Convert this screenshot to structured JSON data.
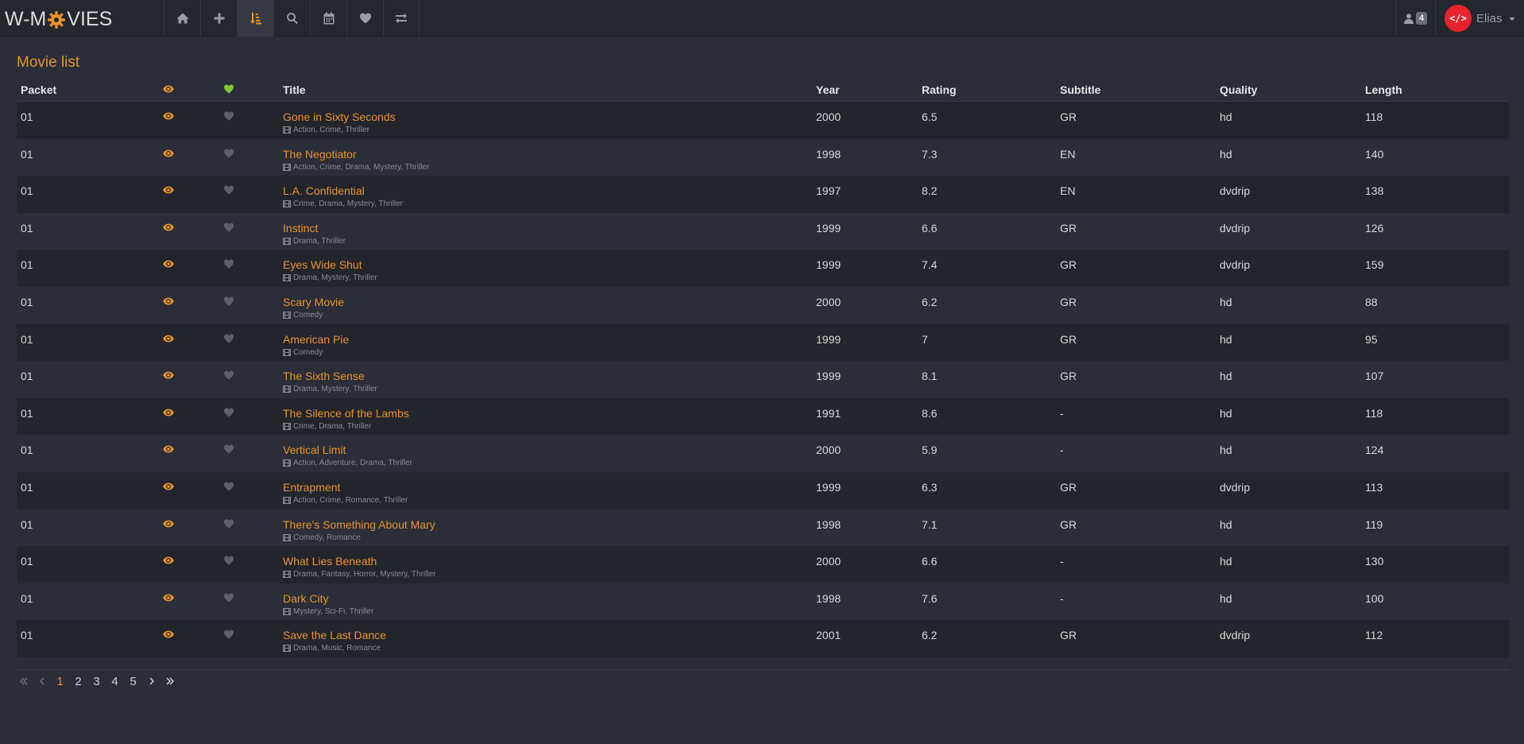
{
  "brand": {
    "pre": "W-M",
    "post": "VIES"
  },
  "nav": [
    {
      "name": "home-icon",
      "active": false
    },
    {
      "name": "plus-icon",
      "active": false
    },
    {
      "name": "sort-amount-icon",
      "active": true
    },
    {
      "name": "search-icon",
      "active": false
    },
    {
      "name": "calendar-icon",
      "active": false
    },
    {
      "name": "heart-icon",
      "active": false
    },
    {
      "name": "exchange-icon",
      "active": false
    }
  ],
  "online_count": "4",
  "user": {
    "avatar_text": "</>",
    "name": "Elias"
  },
  "page_title": "Movie list",
  "columns": {
    "packet": "Packet",
    "title": "Title",
    "year": "Year",
    "rating": "Rating",
    "subtitle": "Subtitle",
    "quality": "Quality",
    "length": "Length"
  },
  "colors": {
    "accent": "#e8922b",
    "liked": "#7ec832",
    "not_liked": "#5d6068",
    "avatar": "#e8232e"
  },
  "movies": [
    {
      "packet": "01",
      "title": "Gone in Sixty Seconds",
      "genres": "Action, Crime, Thriller",
      "year": "2000",
      "rating": "6.5",
      "subtitle": "GR",
      "quality": "hd",
      "length": "118"
    },
    {
      "packet": "01",
      "title": "The Negotiator",
      "genres": "Action, Crime, Drama, Mystery, Thriller",
      "year": "1998",
      "rating": "7.3",
      "subtitle": "EN",
      "quality": "hd",
      "length": "140"
    },
    {
      "packet": "01",
      "title": "L.A. Confidential",
      "genres": "Crime, Drama, Mystery, Thriller",
      "year": "1997",
      "rating": "8.2",
      "subtitle": "EN",
      "quality": "dvdrip",
      "length": "138"
    },
    {
      "packet": "01",
      "title": "Instinct",
      "genres": "Drama, Thriller",
      "year": "1999",
      "rating": "6.6",
      "subtitle": "GR",
      "quality": "dvdrip",
      "length": "126"
    },
    {
      "packet": "01",
      "title": "Eyes Wide Shut",
      "genres": "Drama, Mystery, Thriller",
      "year": "1999",
      "rating": "7.4",
      "subtitle": "GR",
      "quality": "dvdrip",
      "length": "159"
    },
    {
      "packet": "01",
      "title": "Scary Movie",
      "genres": "Comedy",
      "year": "2000",
      "rating": "6.2",
      "subtitle": "GR",
      "quality": "hd",
      "length": "88"
    },
    {
      "packet": "01",
      "title": "American Pie",
      "genres": "Comedy",
      "year": "1999",
      "rating": "7",
      "subtitle": "GR",
      "quality": "hd",
      "length": "95"
    },
    {
      "packet": "01",
      "title": "The Sixth Sense",
      "genres": "Drama, Mystery, Thriller",
      "year": "1999",
      "rating": "8.1",
      "subtitle": "GR",
      "quality": "hd",
      "length": "107"
    },
    {
      "packet": "01",
      "title": "The Silence of the Lambs",
      "genres": "Crime, Drama, Thriller",
      "year": "1991",
      "rating": "8.6",
      "subtitle": "-",
      "quality": "hd",
      "length": "118"
    },
    {
      "packet": "01",
      "title": "Vertical Limit",
      "genres": "Action, Adventure, Drama, Thriller",
      "year": "2000",
      "rating": "5.9",
      "subtitle": "-",
      "quality": "hd",
      "length": "124"
    },
    {
      "packet": "01",
      "title": "Entrapment",
      "genres": "Action, Crime, Romance, Thriller",
      "year": "1999",
      "rating": "6.3",
      "subtitle": "GR",
      "quality": "dvdrip",
      "length": "113"
    },
    {
      "packet": "01",
      "title": "There's Something About Mary",
      "genres": "Comedy, Romance",
      "year": "1998",
      "rating": "7.1",
      "subtitle": "GR",
      "quality": "hd",
      "length": "119"
    },
    {
      "packet": "01",
      "title": "What Lies Beneath",
      "genres": "Drama, Fantasy, Horror, Mystery, Thriller",
      "year": "2000",
      "rating": "6.6",
      "subtitle": "-",
      "quality": "hd",
      "length": "130"
    },
    {
      "packet": "01",
      "title": "Dark City",
      "genres": "Mystery, Sci-Fi, Thriller",
      "year": "1998",
      "rating": "7.6",
      "subtitle": "-",
      "quality": "hd",
      "length": "100"
    },
    {
      "packet": "01",
      "title": "Save the Last Dance",
      "genres": "Drama, Music, Romance",
      "year": "2001",
      "rating": "6.2",
      "subtitle": "GR",
      "quality": "dvdrip",
      "length": "112"
    }
  ],
  "pagination": {
    "pages": [
      "1",
      "2",
      "3",
      "4",
      "5"
    ],
    "current": "1"
  }
}
